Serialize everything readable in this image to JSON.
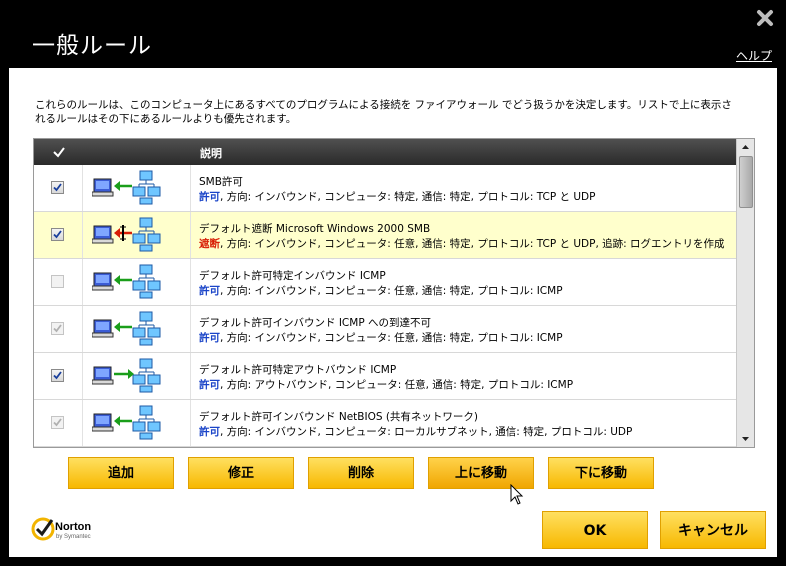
{
  "window": {
    "title": "一般ルール",
    "help_label": "ヘルプ"
  },
  "description": "これらのルールは、このコンピュータ上にあるすべてのプログラムによる接続を ファイアウォール でどう扱うかを決定します。リストで上に表示されるルールはその下にあるルールよりも優先されます。",
  "table": {
    "header_desc": "説明",
    "rows": [
      {
        "checked": true,
        "disabled": false,
        "direction": "inbound",
        "action": "allow",
        "name": "SMB許可",
        "action_label": "許可",
        "detail": ", 方向: インバウンド, コンピュータ: 特定, 通信: 特定, プロトコル: TCP と UDP"
      },
      {
        "checked": true,
        "disabled": false,
        "direction": "inbound",
        "action": "block",
        "name": "デフォルト遮断 Microsoft Windows 2000 SMB",
        "action_label": "遮断",
        "detail": ", 方向: インバウンド, コンピュータ: 任意, 通信: 特定, プロトコル: TCP と UDP, 追跡: ログエントリを作成"
      },
      {
        "checked": false,
        "disabled": true,
        "direction": "inbound",
        "action": "allow",
        "name": "デフォルト許可特定インバウンド ICMP",
        "action_label": "許可",
        "detail": ", 方向: インバウンド, コンピュータ: 任意, 通信: 特定, プロトコル: ICMP"
      },
      {
        "checked": true,
        "disabled": true,
        "direction": "inbound",
        "action": "allow",
        "name": "デフォルト許可インバウンド ICMP への到達不可",
        "action_label": "許可",
        "detail": ", 方向: インバウンド, コンピュータ: 任意, 通信: 特定, プロトコル: ICMP"
      },
      {
        "checked": true,
        "disabled": false,
        "direction": "outbound",
        "action": "allow",
        "name": "デフォルト許可特定アウトバウンド ICMP",
        "action_label": "許可",
        "detail": ", 方向: アウトバウンド, コンピュータ: 任意, 通信: 特定, プロトコル: ICMP"
      },
      {
        "checked": true,
        "disabled": true,
        "direction": "inbound",
        "action": "allow",
        "name": "デフォルト許可インバウンド NetBIOS (共有ネットワーク)",
        "action_label": "許可",
        "detail": ", 方向: インバウンド, コンピュータ: ローカルサブネット, 通信: 特定, プロトコル: UDP"
      }
    ]
  },
  "buttons": {
    "add": "追加",
    "modify": "修正",
    "delete": "削除",
    "move_up": "上に移動",
    "move_down": "下に移動",
    "ok": "OK",
    "cancel": "キャンセル"
  },
  "brand": {
    "name": "Norton",
    "sub": "by Symantec"
  },
  "colors": {
    "button": "#f7c000",
    "allow": "#1a44c8",
    "block": "#d81e05",
    "selected_row": "#ffffcc"
  }
}
